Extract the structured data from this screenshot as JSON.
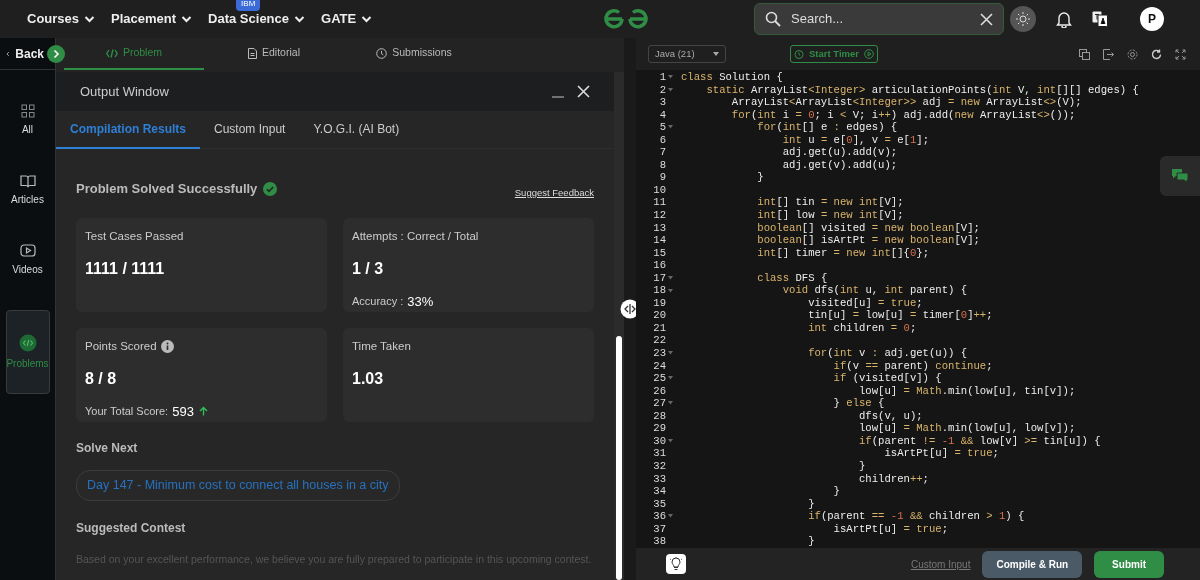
{
  "nav": {
    "menus": [
      {
        "label": "Courses"
      },
      {
        "label": "Placement"
      },
      {
        "label": "Data Science",
        "badge": "IBM"
      },
      {
        "label": "GATE"
      }
    ],
    "search": {
      "placeholder": "Search..."
    },
    "avatar": "P"
  },
  "sidebar": {
    "back": "Back",
    "items": [
      {
        "label": "All",
        "kind": "grid",
        "selected": false
      },
      {
        "label": "Articles",
        "kind": "book",
        "selected": false
      },
      {
        "label": "Videos",
        "kind": "video",
        "selected": false
      },
      {
        "label": "Problems",
        "kind": "code",
        "selected": true
      }
    ]
  },
  "problem_tabs": [
    {
      "label": "Problem",
      "kind": "code",
      "selected": true
    },
    {
      "label": "Editorial",
      "kind": "doc",
      "selected": false
    },
    {
      "label": "Submissions",
      "kind": "clock",
      "selected": false
    }
  ],
  "output_window": {
    "title": "Output Window",
    "tabs": [
      {
        "label": "Compilation Results",
        "selected": true
      },
      {
        "label": "Custom Input",
        "selected": false
      },
      {
        "label": "Y.O.G.I. (AI Bot)",
        "selected": false
      }
    ],
    "status": "Problem Solved Successfully",
    "feedback_link": "Suggest Feedback",
    "stats": [
      {
        "label": "Test Cases Passed",
        "value": "1111 / 1111",
        "info": false
      },
      {
        "label": "Attempts : Correct / Total",
        "value": "1 / 3",
        "info": false,
        "note_label": "Accuracy :",
        "note_value": "33%"
      },
      {
        "label": "Points Scored",
        "value": "8 / 8",
        "info": true,
        "note_label": "Your Total Score:",
        "note_value": "593",
        "rising": true
      },
      {
        "label": "Time Taken",
        "value": "1.03",
        "info": false
      }
    ],
    "solve_next": {
      "heading": "Solve Next",
      "link": "Day 147 - Minimum cost to connect all houses in a city"
    },
    "contest": {
      "heading": "Suggested Contest",
      "text": "Based on your excellent performance, we believe you are fully prepared to participate in this upcoming contest."
    }
  },
  "editor": {
    "language": "Java (21)",
    "timer": "Start Timer",
    "lines": [
      {
        "number": "1",
        "text": "class Solution {",
        "fold": true
      },
      {
        "number": "2",
        "text": "    static ArrayList<Integer> articulationPoints(int V, int[][] edges) {",
        "fold": true
      },
      {
        "number": "3",
        "text": "        ArrayList<ArrayList<Integer>> adj = new ArrayList<>(V);",
        "fold": false
      },
      {
        "number": "4",
        "text": "        for(int i = 0; i < V; i++) adj.add(new ArrayList<>());",
        "fold": false
      },
      {
        "number": "5",
        "text": "            for(int[] e : edges) {",
        "fold": true
      },
      {
        "number": "6",
        "text": "                int u = e[0], v = e[1];",
        "fold": false
      },
      {
        "number": "7",
        "text": "                adj.get(u).add(v);",
        "fold": false
      },
      {
        "number": "8",
        "text": "                adj.get(v).add(u);",
        "fold": false
      },
      {
        "number": "9",
        "text": "            }",
        "fold": false
      },
      {
        "number": "10",
        "fold": false
      },
      {
        "number": "11",
        "text": "            int[] tin = new int[V];",
        "fold": false
      },
      {
        "number": "12",
        "text": "            int[] low = new int[V];",
        "fold": false
      },
      {
        "number": "13",
        "text": "            boolean[] visited = new boolean[V];",
        "fold": false
      },
      {
        "number": "14",
        "text": "            boolean[] isArtPt = new boolean[V];",
        "fold": false
      },
      {
        "number": "15",
        "text": "            int[] timer = new int[]{0};",
        "fold": false
      },
      {
        "number": "16",
        "fold": false
      },
      {
        "number": "17",
        "text": "            class DFS {",
        "fold": true
      },
      {
        "number": "18",
        "text": "                void dfs(int u, int parent) {",
        "fold": true
      },
      {
        "number": "19",
        "text": "                    visited[u] = true;",
        "fold": false
      },
      {
        "number": "20",
        "text": "                    tin[u] = low[u] = timer[0]++;",
        "fold": false
      },
      {
        "number": "21",
        "text": "                    int children = 0;",
        "fold": false
      },
      {
        "number": "22",
        "fold": false
      },
      {
        "number": "23",
        "text": "                    for(int v : adj.get(u)) {",
        "fold": true
      },
      {
        "number": "24",
        "text": "                        if(v == parent) continue;",
        "fold": false
      },
      {
        "number": "25",
        "text": "                        if (visited[v]) {",
        "fold": true
      },
      {
        "number": "26",
        "text": "                            low[u] = Math.min(low[u], tin[v]);",
        "fold": false
      },
      {
        "number": "27",
        "text": "                        } else {",
        "fold": true
      },
      {
        "number": "28",
        "text": "                            dfs(v, u);",
        "fold": false
      },
      {
        "number": "29",
        "text": "                            low[u] = Math.min(low[u], low[v]);",
        "fold": false
      },
      {
        "number": "30",
        "text": "                            if(parent != -1 && low[v] >= tin[u]) {",
        "fold": true
      },
      {
        "number": "31",
        "text": "                                isArtPt[u] = true;",
        "fold": false
      },
      {
        "number": "32",
        "text": "                            }",
        "fold": false
      },
      {
        "number": "33",
        "text": "                            children++;",
        "fold": false
      },
      {
        "number": "34",
        "text": "                        }",
        "fold": false
      },
      {
        "number": "35",
        "text": "                    }",
        "fold": false
      },
      {
        "number": "36",
        "text": "                    if(parent == -1 && children > 1) {",
        "fold": true
      },
      {
        "number": "37",
        "text": "                        isArtPt[u] = true;",
        "fold": false
      },
      {
        "number": "38",
        "text": "                    }",
        "fold": false
      }
    ],
    "custom_input": "Custom Input",
    "run": "Compile & Run",
    "submit": "Submit"
  }
}
